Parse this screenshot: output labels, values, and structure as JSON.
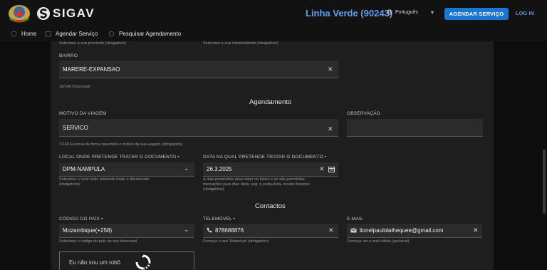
{
  "header": {
    "app_name": "SIGAV",
    "hotline": "Linha Verde (90243)",
    "language": "Português",
    "schedule_button": "AGENDAR SERVIÇO",
    "login_link": "LOG IN"
  },
  "nav": [
    {
      "label": "Home",
      "icon": "home-icon"
    },
    {
      "label": "Agendar Serviço",
      "icon": "calendar-icon"
    },
    {
      "label": "Pesquisar Agendamento",
      "icon": "search-icon"
    }
  ],
  "top_hints": {
    "province": "Selecione a sua província (obrigatório)",
    "city": "Selecione a sua cidade/distrito (obrigatório)"
  },
  "bairro": {
    "label": "BAIRRO",
    "value": "MARERE-EXPANSAO",
    "counter": "15/140 (Opcional)"
  },
  "agendamento": {
    "title": "Agendamento",
    "motivo": {
      "label": "MOTIVO DA VIAGEM",
      "value": "SERVICO",
      "hint": "7/140 Escreva de forma resumida o motivo da sua viagem (obrigatório)"
    },
    "observacao": {
      "label": "OBSERVAÇÃO",
      "value": ""
    },
    "local": {
      "label": "LOCAL ONDE PRETENDE TRATAR O DOCUMENTO •",
      "value": "DPM-NAMPULA",
      "hint_lines": [
        "Selecione o local onde pretende tratar o documento",
        "(obrigatório)"
      ]
    },
    "data": {
      "label": "DATA NA QUAL PRETENDE TRATAR O DOCUMENTO •",
      "value": "26.3.2025",
      "hint_lines": [
        "A data pretendida deve estar no futuro e so são permitidas",
        "marcações para dias úteis, seg. a sexta-feira, excato feriados",
        "(obrigatório)"
      ]
    }
  },
  "contactos": {
    "title": "Contactos",
    "pais": {
      "label": "CÓDIGO DO PAÍS •",
      "value": "Mozambique(+258)",
      "hint": "Selecione o código do país do seu telemóvel"
    },
    "telemovel": {
      "label": "TELEMÓVEL •",
      "value": "878688876",
      "hint": "Forneça o seu Telemóvel (obrigatório)"
    },
    "email": {
      "label": "E-MAIL",
      "value": "lionelpaulolaihequee@gmail.com",
      "hint": "Forneça um e-mail válido (opcional)"
    }
  },
  "captcha": {
    "label": "Eu não sou um robô"
  },
  "colors": {
    "primary": "#1976d2",
    "accent": "#5ea0f0",
    "background": "#101010",
    "panel": "#1e1e1e"
  }
}
